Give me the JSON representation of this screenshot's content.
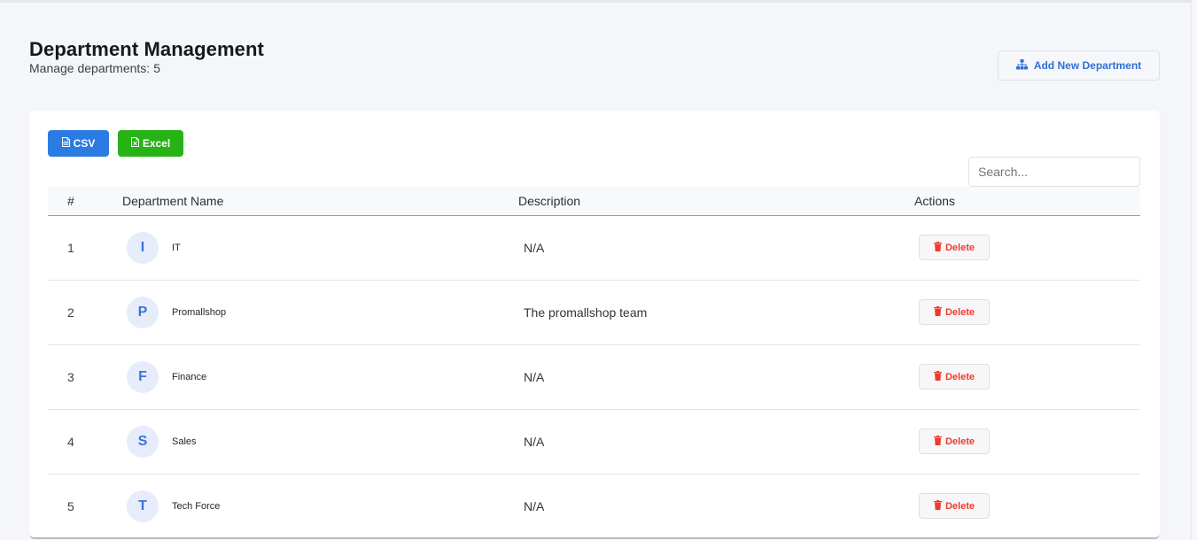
{
  "header": {
    "title": "Department Management",
    "subtitle_label": "Manage departments:",
    "count": "5",
    "add_button_label": "Add New Department"
  },
  "toolbar": {
    "csv_label": "CSV",
    "excel_label": "Excel",
    "search_placeholder": "Search..."
  },
  "table": {
    "columns": [
      "#",
      "Department Name",
      "Description",
      "Actions"
    ],
    "delete_label": "Delete",
    "rows": [
      {
        "num": "1",
        "initial": "I",
        "name": "IT",
        "description": "N/A"
      },
      {
        "num": "2",
        "initial": "P",
        "name": "Promallshop",
        "description": "The promallshop team"
      },
      {
        "num": "3",
        "initial": "F",
        "name": "Finance",
        "description": "N/A"
      },
      {
        "num": "4",
        "initial": "S",
        "name": "Sales",
        "description": "N/A"
      },
      {
        "num": "5",
        "initial": "T",
        "name": "Tech Force",
        "description": "N/A"
      }
    ]
  },
  "colors": {
    "accent_blue": "#2f6fd6",
    "csv_button": "#2b7be3",
    "excel_button": "#27b316",
    "delete_red": "#ef3b2d",
    "avatar_bg": "#e6ecfa"
  },
  "icons": {
    "add_button": "sitemap-icon",
    "csv_button": "file-csv-icon",
    "excel_button": "file-excel-icon",
    "delete_button": "trash-icon"
  }
}
